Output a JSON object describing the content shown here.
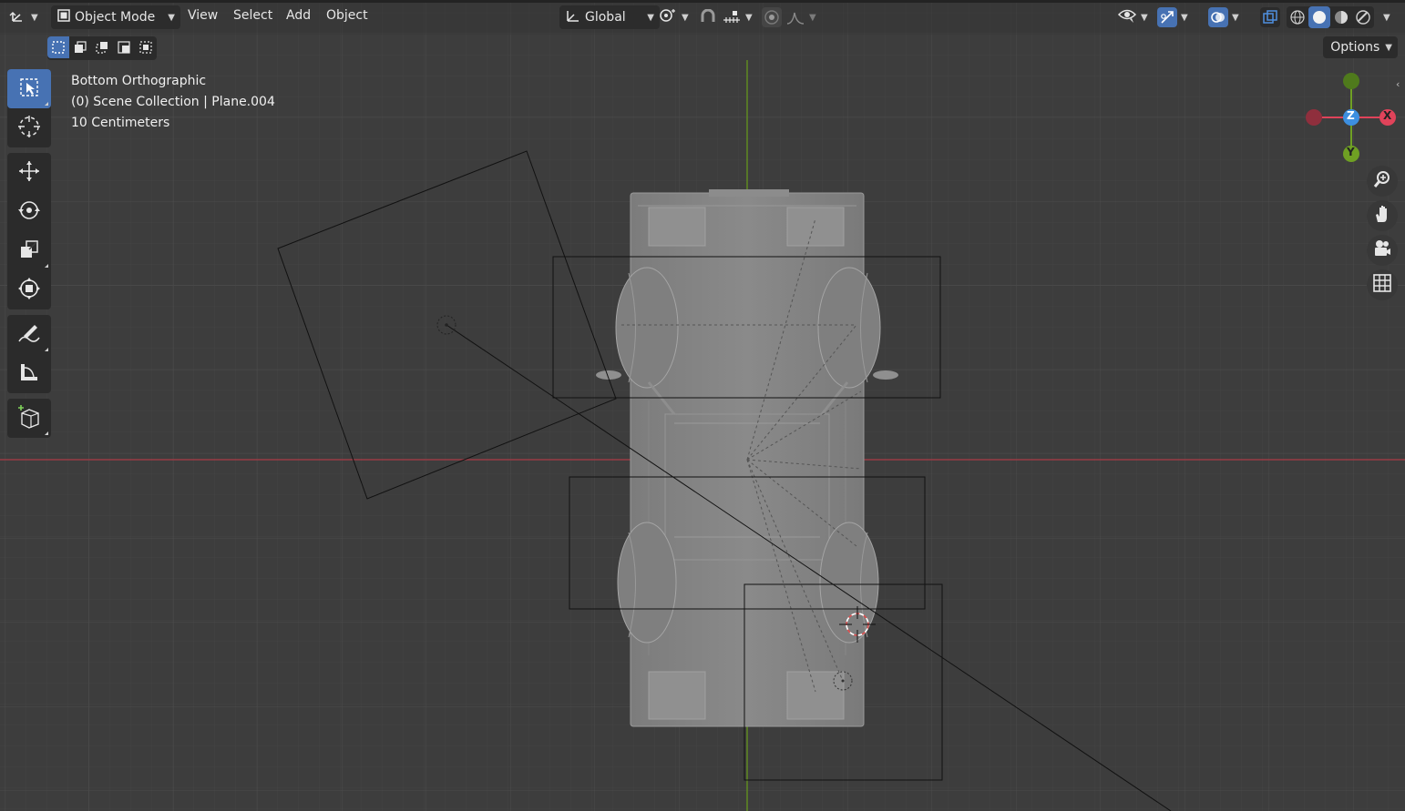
{
  "header": {
    "editor_type_icon": "axes-editor-icon",
    "mode": {
      "label": "Object Mode",
      "icon": "object-mode-icon"
    },
    "menus": [
      "View",
      "Select",
      "Add",
      "Object"
    ],
    "transform_orientation": {
      "label": "Global",
      "icon": "orientation-icon"
    },
    "pivot_icon": "pivot-point-icon",
    "snap_icon": "snap-magnet-icon",
    "snap_target_icon": "snap-increment-icon",
    "proportional_icon": "proportional-edit-icon",
    "falloff_icon": "falloff-curve-icon",
    "visibility_icon": "selectability-eye-icon",
    "gizmo_icon": "gizmo-toggle-icon",
    "overlay_icon": "overlays-icon",
    "xray_icon": "xray-toggle-icon",
    "shading_icons": [
      "wireframe-shading-icon",
      "solid-shading-icon",
      "material-shading-icon",
      "rendered-shading-icon"
    ]
  },
  "select_modes": [
    "select-new-icon",
    "select-extend-icon",
    "select-subtract-icon",
    "select-invert-icon",
    "select-intersect-icon"
  ],
  "options": {
    "label": "Options"
  },
  "viewport_info": {
    "view_name": "Bottom Orthographic",
    "collection": "(0) Scene Collection | Plane.004",
    "grid_scale": "10 Centimeters"
  },
  "toolbar": {
    "tools": [
      "select-box-icon",
      "cursor-icon",
      "move-icon",
      "rotate-icon",
      "scale-icon",
      "transform-icon",
      "annotate-icon",
      "measure-icon",
      "add-cube-icon"
    ]
  },
  "nav_gizmo": {
    "x_label": "X",
    "y_label": "Y",
    "z_label": "Z"
  },
  "nav_tools": [
    "zoom-icon",
    "pan-hand-icon",
    "camera-view-icon",
    "ortho-grid-icon"
  ],
  "colors": {
    "active_blue": "#4772b3",
    "axis_x": "#e0435a",
    "axis_y": "#6fa023",
    "axis_z": "#3d8fe0",
    "grid_bg": "#3d3d3d"
  }
}
